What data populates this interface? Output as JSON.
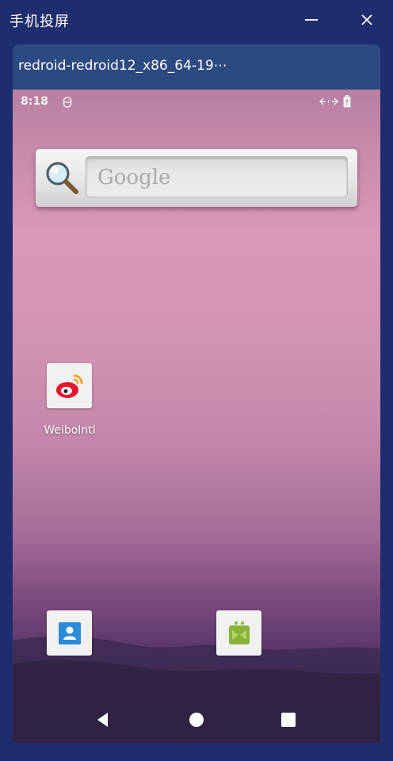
{
  "window": {
    "title": "手机投屏",
    "minimize_icon": "minimize-icon",
    "close_icon": "close-icon"
  },
  "device": {
    "name": "redroid-redroid12_x86_64-19⋯"
  },
  "status_bar": {
    "time": "8:18",
    "icons": [
      "debug-icon",
      "data-transfer-icon",
      "battery-icon"
    ]
  },
  "search_widget": {
    "placeholder": "Google",
    "icon": "magnifier-icon"
  },
  "apps": [
    {
      "label": "WeiboIntl",
      "icon": "weibo-icon"
    }
  ],
  "dock": [
    {
      "icon": "contacts-icon"
    },
    {
      "icon": "android-icon"
    }
  ],
  "nav_bar": {
    "icons": [
      "back-icon",
      "home-icon",
      "recents-icon"
    ]
  },
  "colors": {
    "title_bar": "#1e2d6e",
    "device_header": "#2c4a82",
    "weibo_red": "#e6162d",
    "weibo_orange": "#f5a623",
    "android_green": "#8ab23a",
    "contacts_blue": "#2a8bd8"
  }
}
